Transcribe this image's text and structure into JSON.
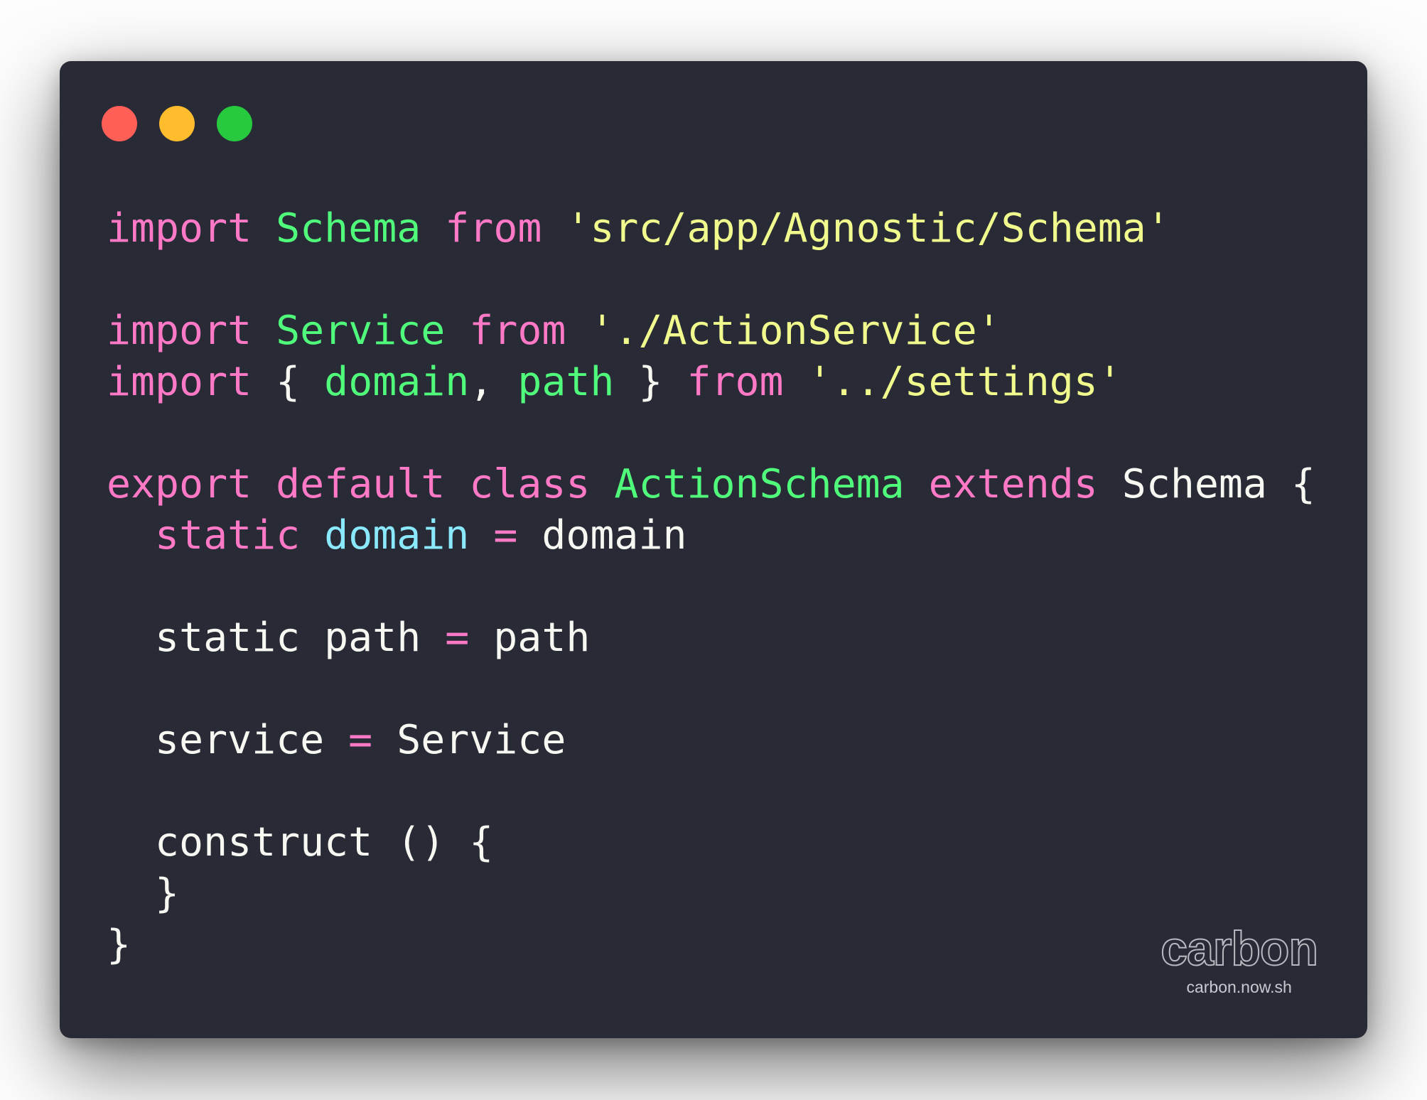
{
  "window": {
    "controls": [
      {
        "name": "close",
        "color": "#ff5f56"
      },
      {
        "name": "minimize",
        "color": "#ffbd2e"
      },
      {
        "name": "maximize",
        "color": "#27c93f"
      }
    ]
  },
  "code": {
    "language": "javascript",
    "lines": [
      [
        {
          "t": "import",
          "k": "kw"
        },
        {
          "t": " ",
          "k": "txt"
        },
        {
          "t": "Schema",
          "k": "cls"
        },
        {
          "t": " ",
          "k": "txt"
        },
        {
          "t": "from",
          "k": "kw"
        },
        {
          "t": " ",
          "k": "txt"
        },
        {
          "t": "'src/app/Agnostic/Schema'",
          "k": "str"
        }
      ],
      [],
      [
        {
          "t": "import",
          "k": "kw"
        },
        {
          "t": " ",
          "k": "txt"
        },
        {
          "t": "Service",
          "k": "cls"
        },
        {
          "t": " ",
          "k": "txt"
        },
        {
          "t": "from",
          "k": "kw"
        },
        {
          "t": " ",
          "k": "txt"
        },
        {
          "t": "'./ActionService'",
          "k": "str"
        }
      ],
      [
        {
          "t": "import",
          "k": "kw"
        },
        {
          "t": " { ",
          "k": "txt"
        },
        {
          "t": "domain",
          "k": "cls"
        },
        {
          "t": ", ",
          "k": "txt"
        },
        {
          "t": "path",
          "k": "cls"
        },
        {
          "t": " } ",
          "k": "txt"
        },
        {
          "t": "from",
          "k": "kw"
        },
        {
          "t": " ",
          "k": "txt"
        },
        {
          "t": "'../settings'",
          "k": "str"
        }
      ],
      [],
      [
        {
          "t": "export",
          "k": "kw"
        },
        {
          "t": " ",
          "k": "txt"
        },
        {
          "t": "default",
          "k": "kw"
        },
        {
          "t": " ",
          "k": "txt"
        },
        {
          "t": "class",
          "k": "kw"
        },
        {
          "t": " ",
          "k": "txt"
        },
        {
          "t": "ActionSchema",
          "k": "cls"
        },
        {
          "t": " ",
          "k": "txt"
        },
        {
          "t": "extends",
          "k": "kw"
        },
        {
          "t": " Schema {",
          "k": "txt"
        }
      ],
      [
        {
          "t": "  ",
          "k": "txt"
        },
        {
          "t": "static",
          "k": "kw"
        },
        {
          "t": " ",
          "k": "txt"
        },
        {
          "t": "domain",
          "k": "prop"
        },
        {
          "t": " ",
          "k": "txt"
        },
        {
          "t": "=",
          "k": "kw"
        },
        {
          "t": " domain",
          "k": "txt"
        }
      ],
      [],
      [
        {
          "t": "  static path ",
          "k": "txt"
        },
        {
          "t": "=",
          "k": "kw"
        },
        {
          "t": " path",
          "k": "txt"
        }
      ],
      [],
      [
        {
          "t": "  service ",
          "k": "txt"
        },
        {
          "t": "=",
          "k": "kw"
        },
        {
          "t": " Service",
          "k": "txt"
        }
      ],
      [],
      [
        {
          "t": "  construct () {",
          "k": "txt"
        }
      ],
      [
        {
          "t": "  }",
          "k": "txt"
        }
      ],
      [
        {
          "t": "}",
          "k": "txt"
        }
      ]
    ]
  },
  "watermark": {
    "logo": "carbon",
    "url": "carbon.now.sh"
  }
}
